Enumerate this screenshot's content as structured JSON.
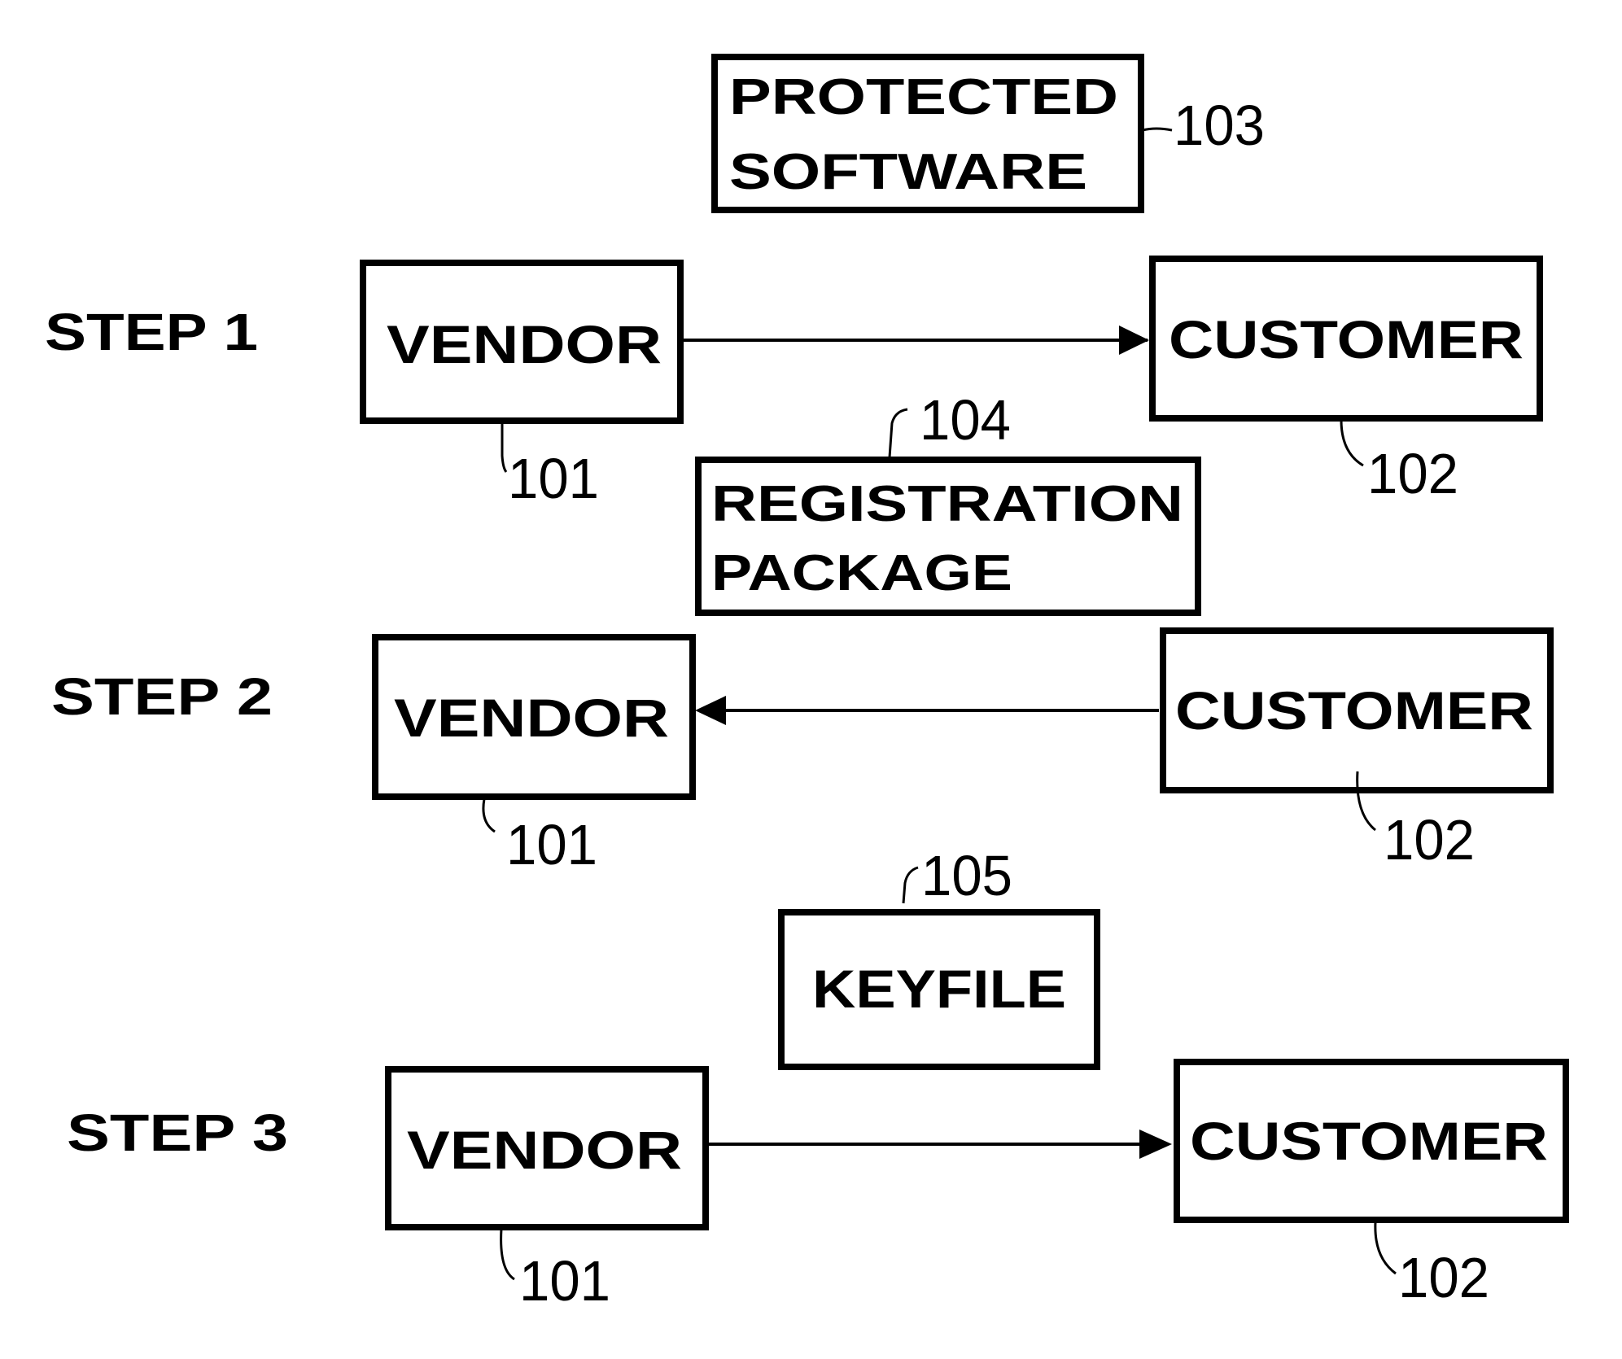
{
  "diagram": {
    "protected_software": {
      "line1": "PROTECTED",
      "line2": "SOFTWARE",
      "ref": "103"
    },
    "registration_package": {
      "line1": "REGISTRATION",
      "line2": "PACKAGE",
      "ref": "104"
    },
    "keyfile": {
      "label": "KEYFILE",
      "ref": "105"
    },
    "steps": [
      {
        "label": "STEP 1",
        "vendor": "VENDOR",
        "vendor_ref": "101",
        "customer": "CUSTOMER",
        "customer_ref": "102",
        "direction": "vendor-to-customer"
      },
      {
        "label": "STEP 2",
        "vendor": "VENDOR",
        "vendor_ref": "101",
        "customer": "CUSTOMER",
        "customer_ref": "102",
        "direction": "customer-to-vendor"
      },
      {
        "label": "STEP 3",
        "vendor": "VENDOR",
        "vendor_ref": "101",
        "customer": "CUSTOMER",
        "customer_ref": "102",
        "direction": "vendor-to-customer"
      }
    ]
  }
}
